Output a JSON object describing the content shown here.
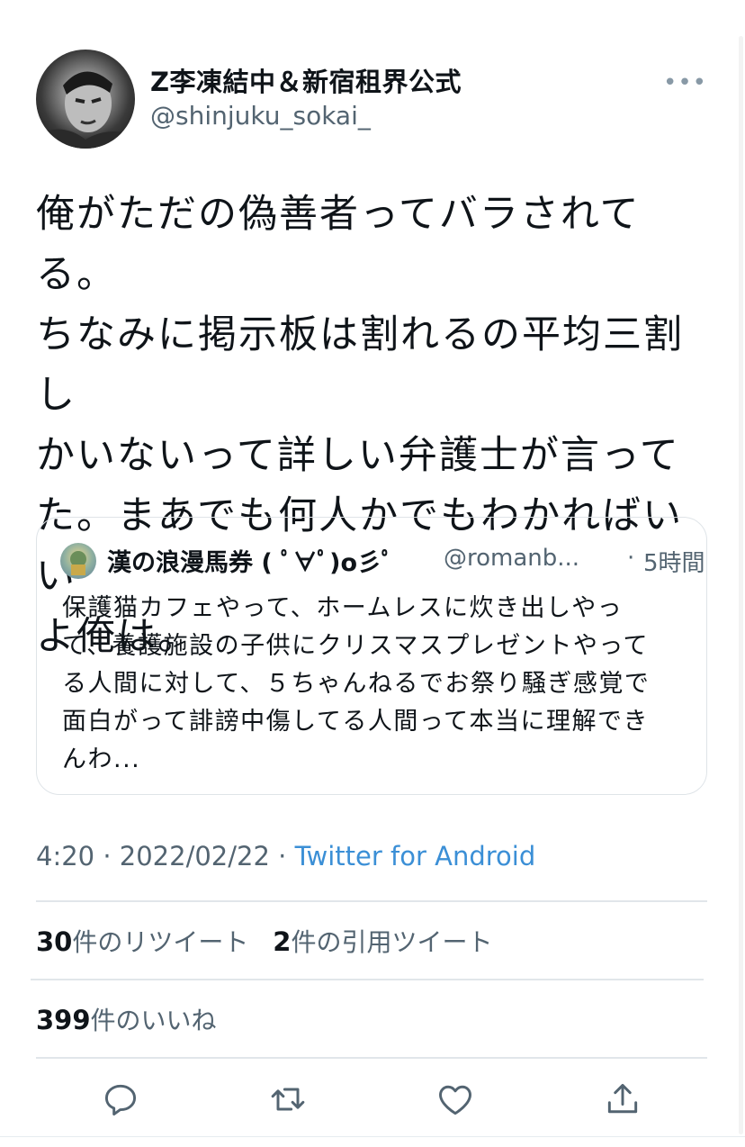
{
  "author": {
    "display_name": "Z李凍結中＆新宿租界公式",
    "handle": "@shinjuku_sokai_"
  },
  "more_label": "•••",
  "tweet": {
    "text": "俺がただの偽善者ってバラされてる。\nちなみに掲示板は割れるの平均三割し\nかいないって詳しい弁護士が言って\nた。まあでも何人かでもわかればいい\nよ俺は。"
  },
  "quoted": {
    "display_name": "漢の浪漫馬券 ( ﾟ∀ﾟ)o彡ﾟ",
    "handle": "@romanb...",
    "separator": "·",
    "time": "5時間",
    "text": "保護猫カフェやって、ホームレスに炊き出しやっ\nて、養護施設の子供にクリスマスプレゼントやって\nる人間に対して、５ちゃんねるでお祭り騒ぎ感覚で\n面白がって誹謗中傷してる人間って本当に理解でき\nんわ..."
  },
  "meta": {
    "time": "4:20",
    "dot1": " · ",
    "date": "2022/02/22",
    "dot2": " · ",
    "source": "Twitter for Android"
  },
  "stats": {
    "retweets_count": "30",
    "retweets_label": "件のリツイート",
    "quotes_count": "2",
    "quotes_label": "件の引用ツイート",
    "likes_count": "399",
    "likes_label": "件のいいね"
  },
  "colors": {
    "accent": "#3b8fd6",
    "secondary_text": "#536471",
    "divider": "#e1e6ea"
  },
  "actions": [
    "reply-icon",
    "retweet-icon",
    "like-icon",
    "share-icon"
  ]
}
